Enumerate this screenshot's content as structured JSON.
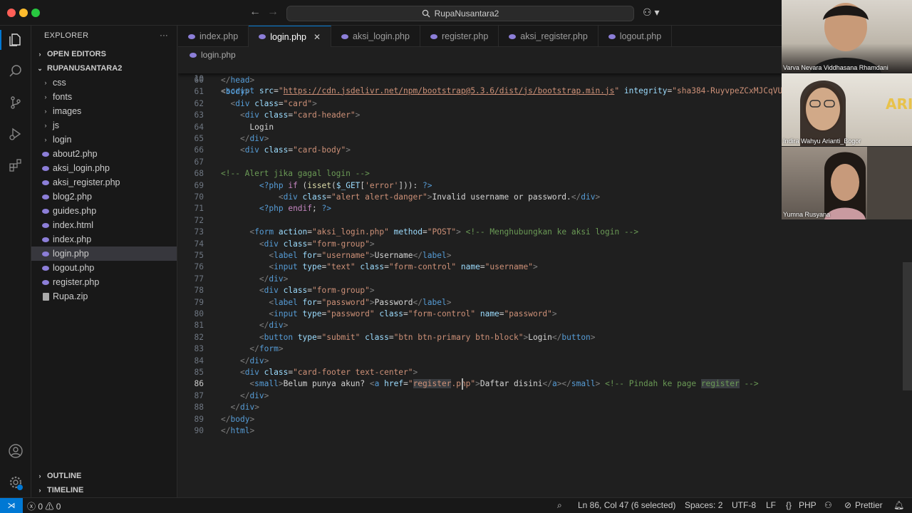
{
  "window": {
    "search_text": "RupaNusantara2"
  },
  "sidebar": {
    "title": "EXPLORER",
    "more": "···",
    "open_editors": "OPEN EDITORS",
    "project": "RUPANUSANTARA2",
    "folders": [
      "css",
      "fonts",
      "images",
      "js",
      "login"
    ],
    "files": [
      "about2.php",
      "aksi_login.php",
      "aksi_register.php",
      "blog2.php",
      "guides.php",
      "index.html",
      "index.php",
      "login.php",
      "logout.php",
      "register.php",
      "Rupa.zip"
    ],
    "outline": "OUTLINE",
    "timeline": "TIMELINE"
  },
  "tabs": [
    "index.php",
    "login.php",
    "aksi_login.php",
    "register.php",
    "aksi_register.php",
    "logout.php"
  ],
  "breadcrumb": "login.php",
  "editor": {
    "sticky_line_no": "10",
    "line_numbers": [
      "60",
      "61",
      "62",
      "63",
      "64",
      "65",
      "66",
      "67",
      "68",
      "69",
      "70",
      "71",
      "72",
      "73",
      "74",
      "75",
      "76",
      "77",
      "78",
      "79",
      "80",
      "81",
      "82",
      "83",
      "84",
      "85",
      "86",
      "87",
      "88",
      "89",
      "90"
    ],
    "current_line": "86"
  },
  "participants": [
    "Varva Nevara Viddhasana Rhamdani",
    "Indira Wahyu Arianti_Bogor",
    "Yumna Rusyana"
  ],
  "statusbar": {
    "errors": "0",
    "warnings": "0",
    "position": "Ln 86, Col 47 (6 selected)",
    "spaces": "Spaces: 2",
    "encoding": "UTF-8",
    "eol": "LF",
    "language": "PHP",
    "formatter": "Prettier"
  },
  "colors": {
    "accent": "#0078d4",
    "background": "#1f1f1f",
    "panel": "#181818"
  }
}
